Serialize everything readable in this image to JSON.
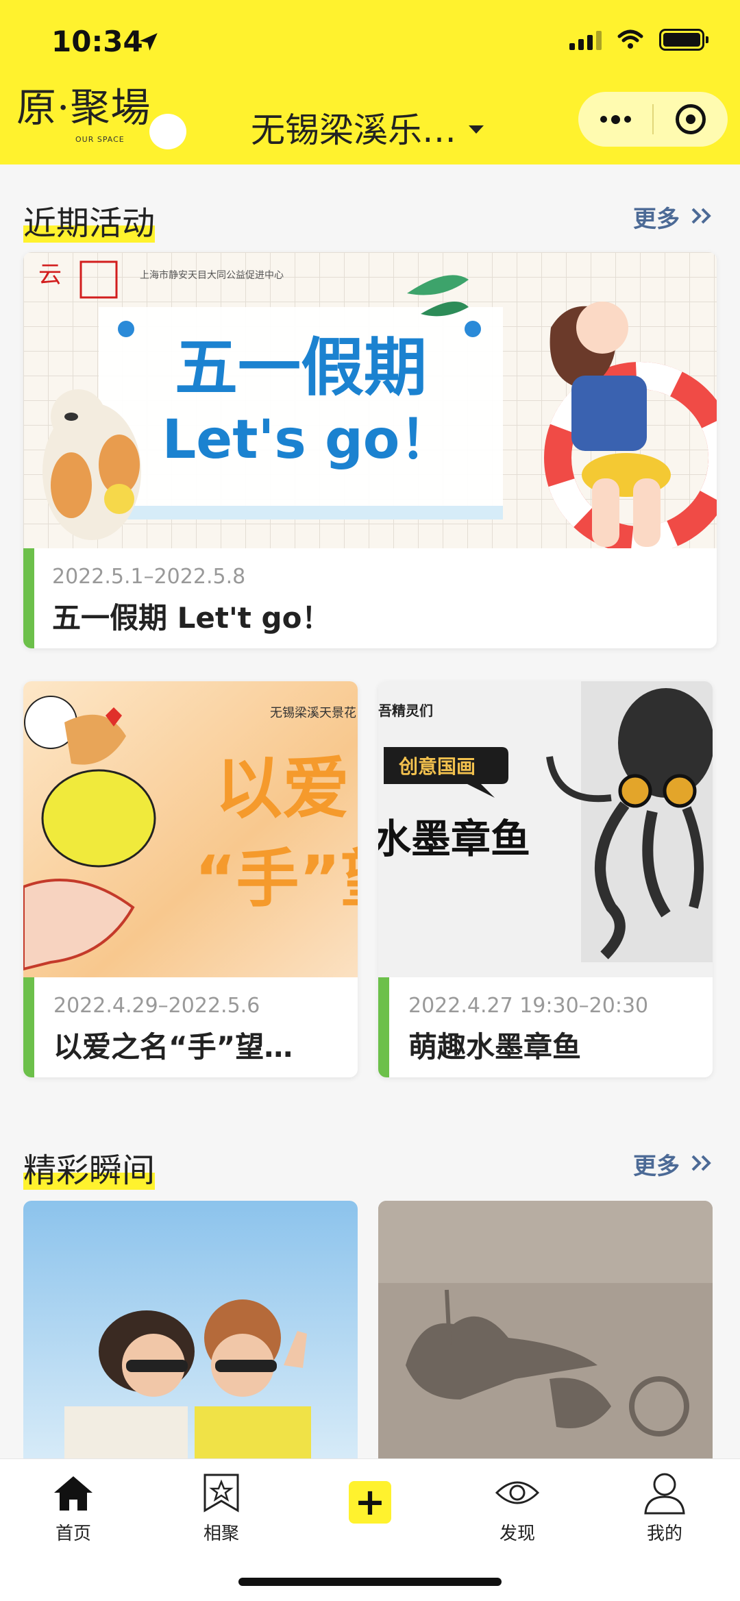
{
  "status_bar": {
    "time": "10:34"
  },
  "header": {
    "logo_text": "原·聚場",
    "logo_sub": "OUR SPACE",
    "location": "无锡梁溪乐…"
  },
  "sections": {
    "recent": {
      "title": "近期活动",
      "more": "更多"
    },
    "moments": {
      "title": "精彩瞬间",
      "more": "更多"
    }
  },
  "activities": [
    {
      "date": "2022.5.1–2022.5.8",
      "title": "五一假期 Let't go！",
      "banner_org": "上海市静安天目大同公益促进中心",
      "banner_headline": "五一假期",
      "banner_sub": "Let's go！"
    },
    {
      "date": "2022.4.29–2022.5.6",
      "title": "以爱之名“手”望…",
      "banner_org": "无锡梁溪天景花",
      "banner_line1": "以爱",
      "banner_line2": "“手”望"
    },
    {
      "date": "2022.4.27 19:30–20:30",
      "title": "萌趣水墨章鱼",
      "banner_tag": "创意国画",
      "banner_top": "吾精灵们",
      "banner_headline": "水墨章鱼"
    }
  ],
  "tabbar": [
    {
      "label": "首页",
      "icon": "home-icon"
    },
    {
      "label": "相聚",
      "icon": "bookmark-star-icon"
    },
    {
      "label": "",
      "icon": "plus-icon"
    },
    {
      "label": "发现",
      "icon": "eye-icon"
    },
    {
      "label": "我的",
      "icon": "user-icon"
    }
  ],
  "colors": {
    "brand_yellow": "#fff22e",
    "accent_green": "#6cc04a",
    "link_blue": "#4c6a96"
  }
}
